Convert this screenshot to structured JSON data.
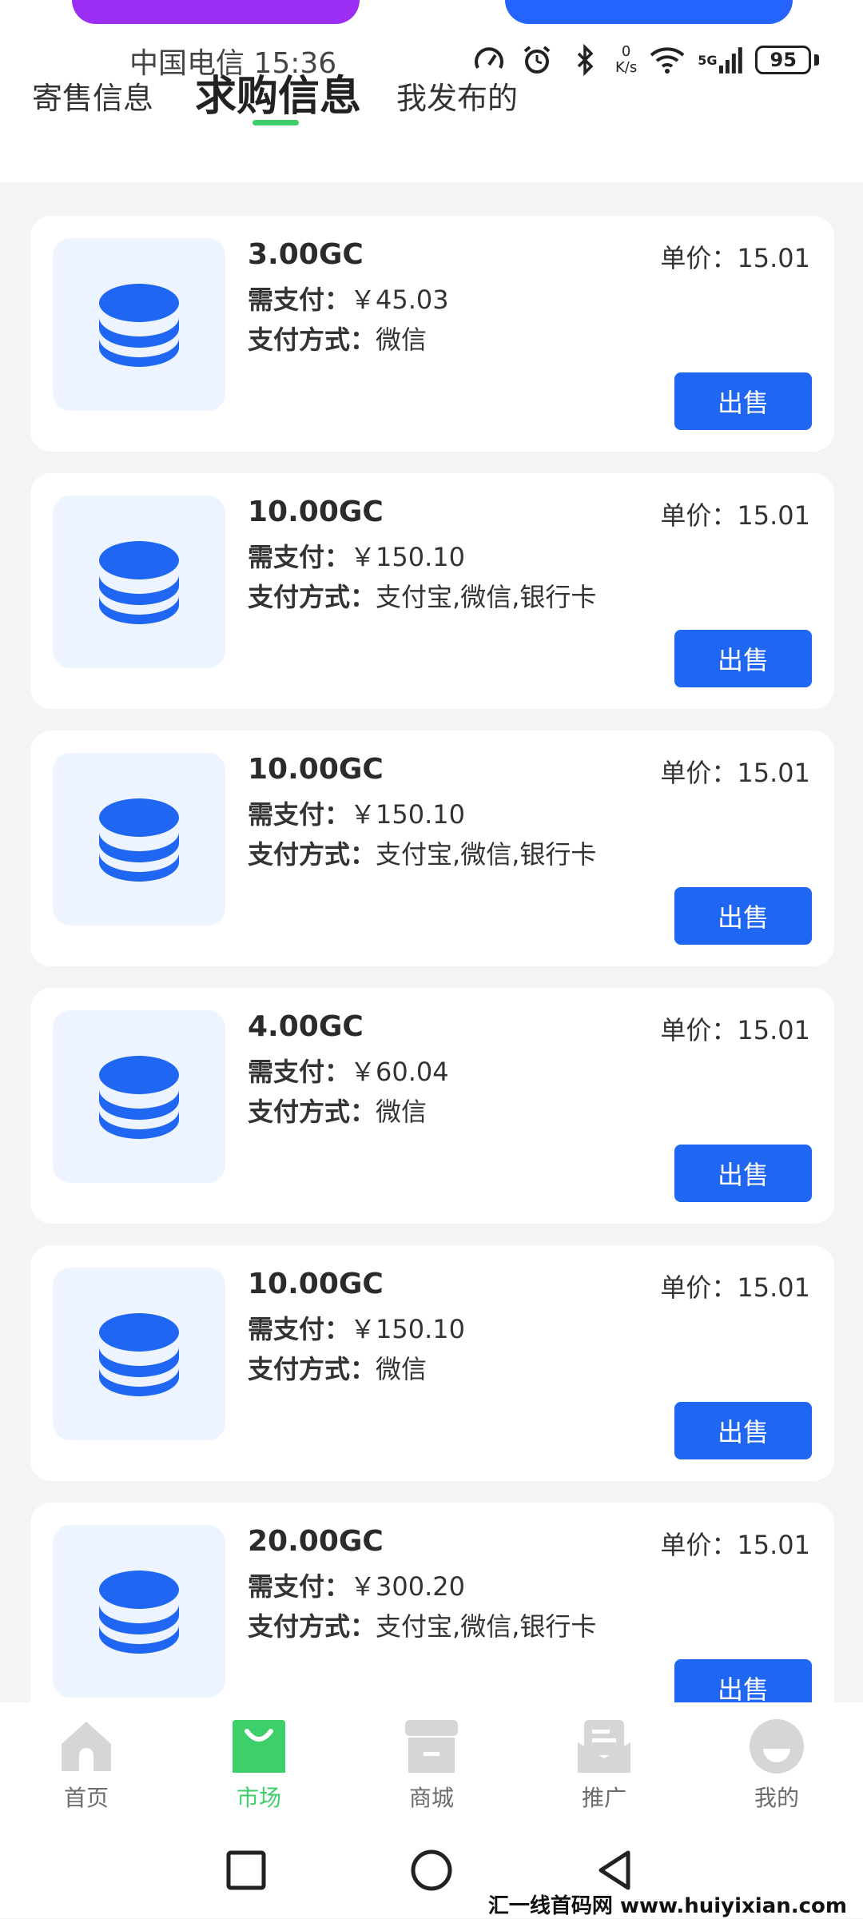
{
  "colors": {
    "accent_blue": "#1f66f2",
    "tab_indicator_green": "#3dcf69",
    "nav_active_green": "#3dcf69",
    "card_icon_bg": "#eef4ff"
  },
  "status_bar": {
    "carrier_time": "中国电信 15:36",
    "speed_value": "0",
    "speed_unit": "K/s",
    "network": "5G",
    "battery": "95"
  },
  "tabs": [
    {
      "label": "寄售信息",
      "active": false
    },
    {
      "label": "求购信息",
      "active": true
    },
    {
      "label": "我发布的",
      "active": false
    }
  ],
  "labels": {
    "need_pay": "需支付：",
    "pay_method": "支付方式：",
    "unit_price": "单价：",
    "sell_button": "出售"
  },
  "orders": [
    {
      "amount": "3.00GC",
      "pay": "￥45.03",
      "method": "微信",
      "unit_price": "15.01"
    },
    {
      "amount": "10.00GC",
      "pay": "￥150.10",
      "method": "支付宝,微信,银行卡",
      "unit_price": "15.01"
    },
    {
      "amount": "10.00GC",
      "pay": "￥150.10",
      "method": "支付宝,微信,银行卡",
      "unit_price": "15.01"
    },
    {
      "amount": "4.00GC",
      "pay": "￥60.04",
      "method": "微信",
      "unit_price": "15.01"
    },
    {
      "amount": "10.00GC",
      "pay": "￥150.10",
      "method": "微信",
      "unit_price": "15.01"
    },
    {
      "amount": "20.00GC",
      "pay": "￥300.20",
      "method": "支付宝,微信,银行卡",
      "unit_price": "15.01"
    }
  ],
  "bottom_nav": [
    {
      "label": "首页",
      "icon": "home-icon",
      "active": false
    },
    {
      "label": "市场",
      "icon": "shopping-bag-icon",
      "active": true
    },
    {
      "label": "商城",
      "icon": "store-icon",
      "active": false
    },
    {
      "label": "推广",
      "icon": "envelope-icon",
      "active": false
    },
    {
      "label": "我的",
      "icon": "profile-icon",
      "active": false
    }
  ],
  "watermark": "汇一线首码网 www.huiyixian.com"
}
